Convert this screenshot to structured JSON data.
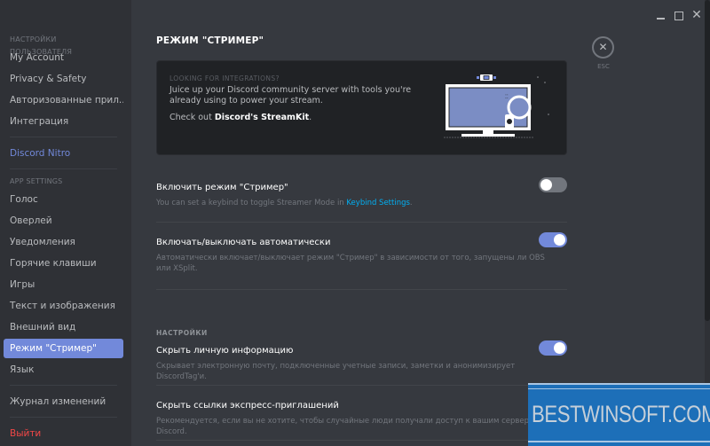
{
  "window": {
    "controls": [
      "minimize",
      "maximize",
      "close"
    ],
    "close_glyph": "✕"
  },
  "sidebar": {
    "user_settings_header": "НАСТРОЙКИ ПОЛЬЗОВАТЕЛЯ",
    "user_items": [
      {
        "label": "My Account"
      },
      {
        "label": "Privacy & Safety"
      },
      {
        "label": "Авторизованные прил..."
      },
      {
        "label": "Интеграция"
      }
    ],
    "nitro_label": "Discord Nitro",
    "app_settings_header": "APP SETTINGS",
    "app_items": [
      {
        "label": "Голос"
      },
      {
        "label": "Оверлей"
      },
      {
        "label": "Уведомления"
      },
      {
        "label": "Горячие клавиши"
      },
      {
        "label": "Игры"
      },
      {
        "label": "Текст и изображения"
      },
      {
        "label": "Внешний вид"
      },
      {
        "label": "Режим \"Стример\"",
        "active": true
      },
      {
        "label": "Язык"
      }
    ],
    "changelog_label": "Журнал изменений",
    "logout_label": "Выйти"
  },
  "main": {
    "title": "РЕЖИМ \"СТРИМЕР\"",
    "promo": {
      "eyebrow": "LOOKING FOR INTEGRATIONS?",
      "text": "Juice up your Discord community server with tools you're already using to power your stream.",
      "link_prefix": "Check out ",
      "link_label": "Discord's StreamKit",
      "link_suffix": "."
    },
    "settings": [
      {
        "title": "Включить режим \"Стример\"",
        "desc_prefix": "You can set a keybind to toggle Streamer Mode in ",
        "desc_link": "Keybind Settings",
        "desc_suffix": ".",
        "enabled": false
      },
      {
        "title": "Включать/выключать автоматически",
        "desc": "Автоматически включает/выключает режим \"Стример\" в зависимости от того, запущены ли OBS или XSplit.",
        "enabled": true
      }
    ],
    "section_label": "НАСТРОЙКИ",
    "options": [
      {
        "title": "Скрыть личную информацию",
        "desc": "Скрывает электронную почту, подключенные учетные записи, заметки и анонимизирует DiscordTag'и.",
        "enabled": true
      },
      {
        "title": "Скрыть ссылки экспресс-приглашений",
        "desc": "Рекомендуется, если вы не хотите, чтобы случайные люди получали доступ к вашим серверам Discord."
      }
    ],
    "esc": {
      "icon": "✕",
      "label": "ESC"
    }
  },
  "watermark": {
    "text": "BESTWINSOFT.COM"
  },
  "colors": {
    "accent": "#7289da",
    "link": "#00b0f4",
    "danger": "#f04747",
    "sidebar_bg": "#2f3136",
    "main_bg": "#36393f",
    "promo_bg": "#202225"
  }
}
